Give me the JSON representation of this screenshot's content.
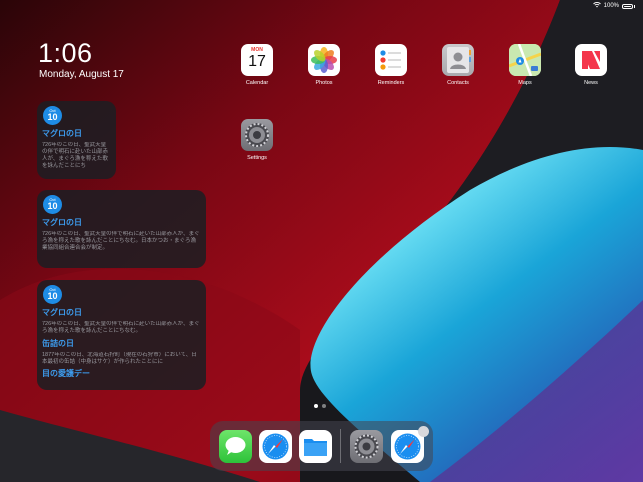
{
  "status_bar": {
    "battery": "100%"
  },
  "lock": {
    "time": "1:06",
    "date": "Monday, August 17"
  },
  "widgets": [
    {
      "badge_month": "Oct",
      "badge_day": "10",
      "title": "マグロの日",
      "text": "726年のこの日、聖武天皇の伴で明石に赴いた山部赤人が、まぐろ漁を称えた歌を詠んだことにち"
    },
    {
      "badge_month": "Oct",
      "badge_day": "10",
      "title": "マグロの日",
      "text": "726年のこの日、聖武天皇の伴で明石に赴いた山部赤人が、まぐろ漁を称えた歌を詠んだことにちなむ。日本かつお・まぐろ漁業協同組合連合会が制定。"
    },
    {
      "badge_month": "Oct",
      "badge_day": "10",
      "title": "マグロの日",
      "text": "726年のこの日、聖武天皇の伴で明石に赴いた山部赤人が、まぐろ漁を称えた歌を詠んだことにちなむ。",
      "title2": "缶詰の日",
      "text2": "1877年のこの日、北海道石狩町（現在の石狩市）において、日本最初の缶詰（中身はサケ）が作られたことにに",
      "title3": "目の愛護デー"
    }
  ],
  "apps": [
    {
      "label": "Calendar",
      "cal_month": "MON",
      "cal_day": "17"
    },
    {
      "label": "Photos"
    },
    {
      "label": "Reminders"
    },
    {
      "label": "Contacts"
    },
    {
      "label": "Maps"
    },
    {
      "label": "News"
    },
    {
      "label": "Settings"
    }
  ],
  "dock": {
    "apps": [
      "Messages",
      "Safari",
      "Files",
      "Settings",
      "Safari"
    ]
  }
}
